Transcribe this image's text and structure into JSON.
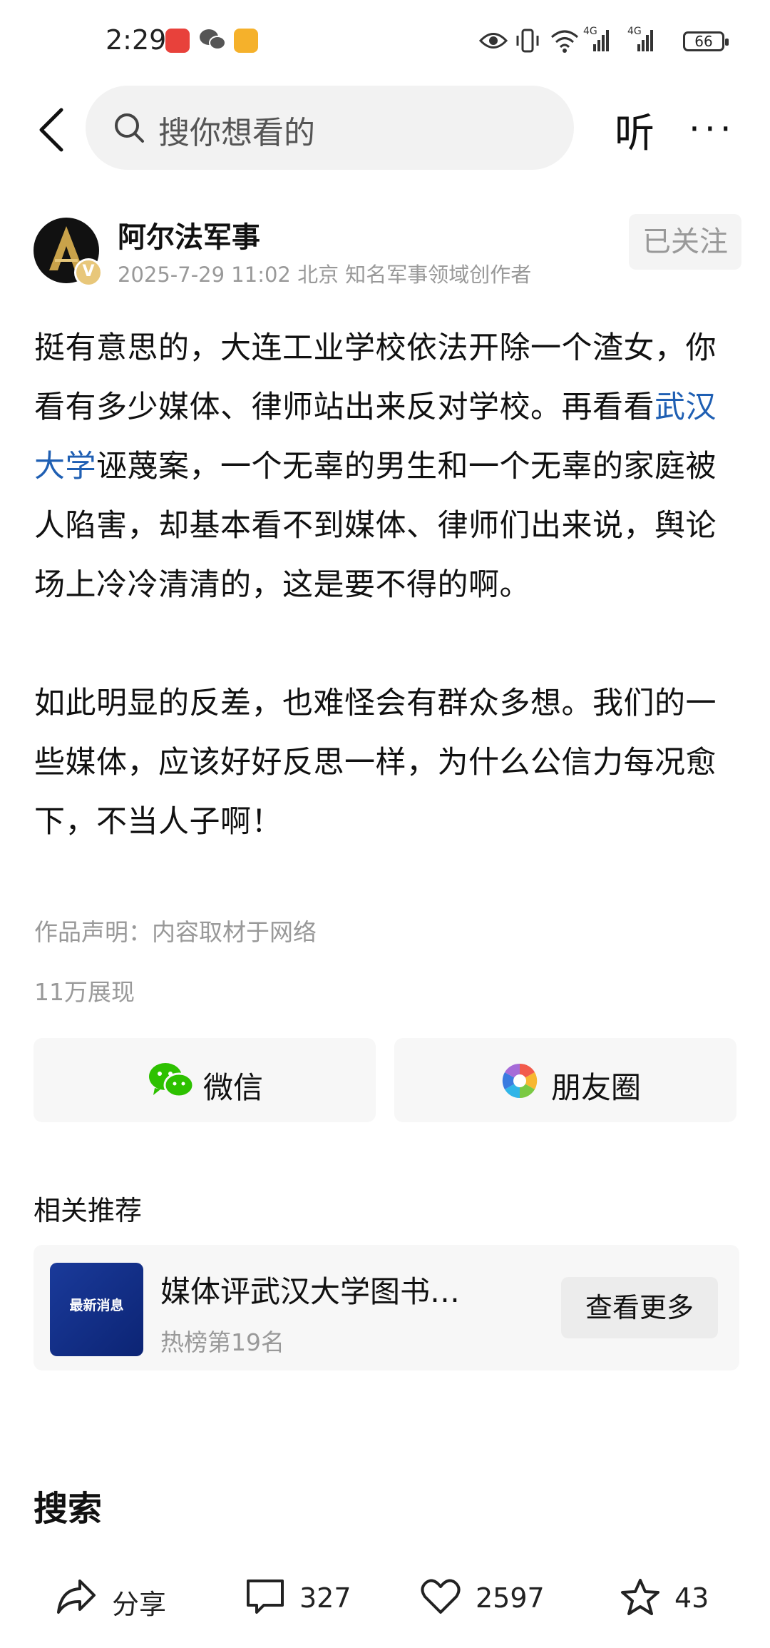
{
  "status_bar": {
    "time": "2:29",
    "battery": "66",
    "network_1": "4G",
    "network_2": "4G"
  },
  "nav": {
    "search_placeholder": "搜你想看的",
    "listen_label": "听",
    "more_label": "···"
  },
  "author": {
    "name": "阿尔法军事",
    "meta": "2025-7-29 11:02 北京 知名军事领域创作者",
    "follow_label": "已关注",
    "verified_badge": "V"
  },
  "article": {
    "paragraph1_before_link": "挺有意思的，大连工业学校依法开除一个渣女，你看有多少媒体、律师站出来反对学校。再看看",
    "link_text": "武汉大学",
    "paragraph1_after_link": "诬蔑案，一个无辜的男生和一个无辜的家庭被人陷害，却基本看不到媒体、律师们出来说，舆论场上冷冷清清的，这是要不得的啊。",
    "paragraph2": "如此明显的反差，也难怪会有群众多想。我们的一些媒体，应该好好反思一样，为什么公信力每况愈下，不当人子啊！",
    "declaration": "作品声明：内容取材于网络",
    "views": "11万展现"
  },
  "share": {
    "wechat_label": "微信",
    "moments_label": "朋友圈"
  },
  "related": {
    "title": "相关推荐",
    "thumb_text": "最新消息",
    "headline": "媒体评武汉大学图书…",
    "subtitle": "热榜第19名",
    "see_more_label": "查看更多"
  },
  "search_heading": "搜索",
  "actions": {
    "share_label": "分享",
    "comments": "327",
    "likes": "2597",
    "favorites": "43"
  },
  "colors": {
    "link": "#1f5fb3",
    "wechat_green": "#2dc100",
    "muted_text": "#999999"
  }
}
